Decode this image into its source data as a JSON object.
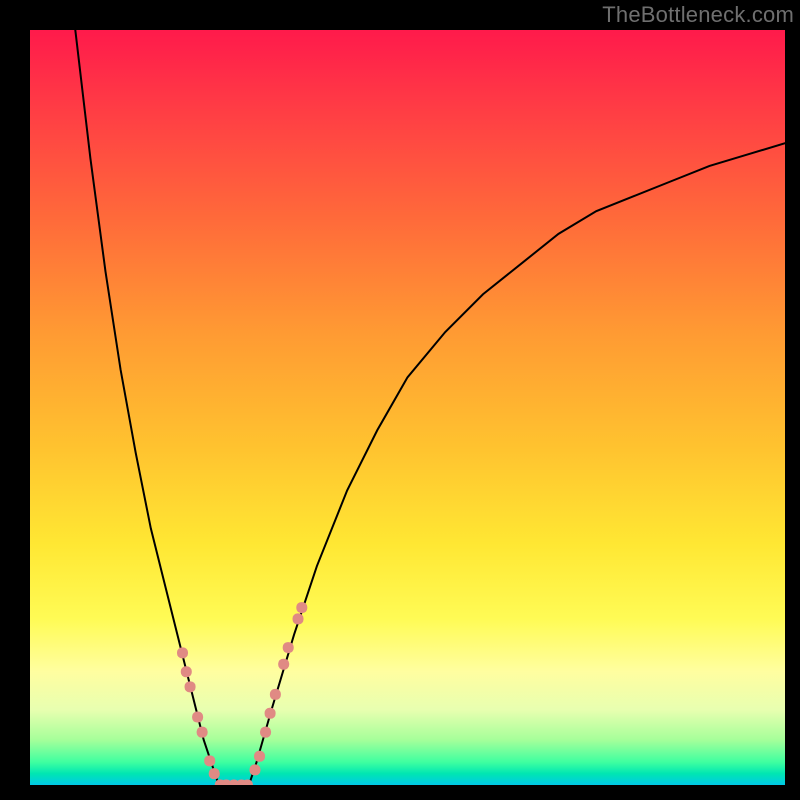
{
  "watermark": "TheBottleneck.com",
  "chart_data": {
    "type": "line",
    "title": "",
    "xlabel": "",
    "ylabel": "",
    "xlim": [
      0,
      100
    ],
    "ylim": [
      0,
      100
    ],
    "legend": false,
    "grid": false,
    "background_gradient": {
      "direction": "vertical",
      "stops": [
        {
          "pos": 0.0,
          "color": "#ff1a4b"
        },
        {
          "pos": 0.1,
          "color": "#ff3b45"
        },
        {
          "pos": 0.25,
          "color": "#ff6a3a"
        },
        {
          "pos": 0.4,
          "color": "#ff9a33"
        },
        {
          "pos": 0.55,
          "color": "#ffc22f"
        },
        {
          "pos": 0.68,
          "color": "#ffe733"
        },
        {
          "pos": 0.78,
          "color": "#fffb55"
        },
        {
          "pos": 0.85,
          "color": "#fffea0"
        },
        {
          "pos": 0.9,
          "color": "#e8ffb0"
        },
        {
          "pos": 0.94,
          "color": "#a6ff9a"
        },
        {
          "pos": 0.97,
          "color": "#3effa0"
        },
        {
          "pos": 0.985,
          "color": "#00e6b2"
        },
        {
          "pos": 1.0,
          "color": "#00c8e6"
        }
      ]
    },
    "series": [
      {
        "name": "left-branch",
        "x": [
          6,
          8,
          10,
          12,
          14,
          16,
          18,
          20,
          22,
          23,
          24,
          25
        ],
        "y": [
          100,
          83,
          68,
          55,
          44,
          34,
          26,
          18,
          10,
          6,
          3,
          0
        ],
        "color": "#000000",
        "linewidth": 2
      },
      {
        "name": "valley-floor",
        "x": [
          25,
          26,
          27,
          28,
          29
        ],
        "y": [
          0,
          0,
          0,
          0,
          0
        ],
        "color": "#000000",
        "linewidth": 2
      },
      {
        "name": "right-branch",
        "x": [
          29,
          30,
          32,
          35,
          38,
          42,
          46,
          50,
          55,
          60,
          65,
          70,
          75,
          80,
          85,
          90,
          95,
          100
        ],
        "y": [
          0,
          3,
          10,
          20,
          29,
          39,
          47,
          54,
          60,
          65,
          69,
          73,
          76,
          78,
          80,
          82,
          83.5,
          85
        ],
        "color": "#000000",
        "linewidth": 2
      }
    ],
    "marker_series": [
      {
        "name": "left-dash-markers",
        "x": [
          20.2,
          20.7,
          21.2,
          22.2,
          22.8,
          23.8,
          24.4
        ],
        "y": [
          17.5,
          15.0,
          13.0,
          9.0,
          7.0,
          3.2,
          1.5
        ],
        "color": "#e08a84",
        "size": 11
      },
      {
        "name": "floor-dash-markers",
        "x": [
          25.2,
          26.0,
          27.0,
          28.0,
          28.8
        ],
        "y": [
          0,
          0,
          0,
          0,
          0
        ],
        "color": "#e08a84",
        "size": 11
      },
      {
        "name": "right-dash-markers",
        "x": [
          29.8,
          30.4,
          31.2,
          31.8,
          32.5,
          33.6,
          34.2,
          35.5,
          36.0
        ],
        "y": [
          2.0,
          3.8,
          7.0,
          9.5,
          12.0,
          16.0,
          18.2,
          22.0,
          23.5
        ],
        "color": "#e08a84",
        "size": 11
      }
    ]
  }
}
